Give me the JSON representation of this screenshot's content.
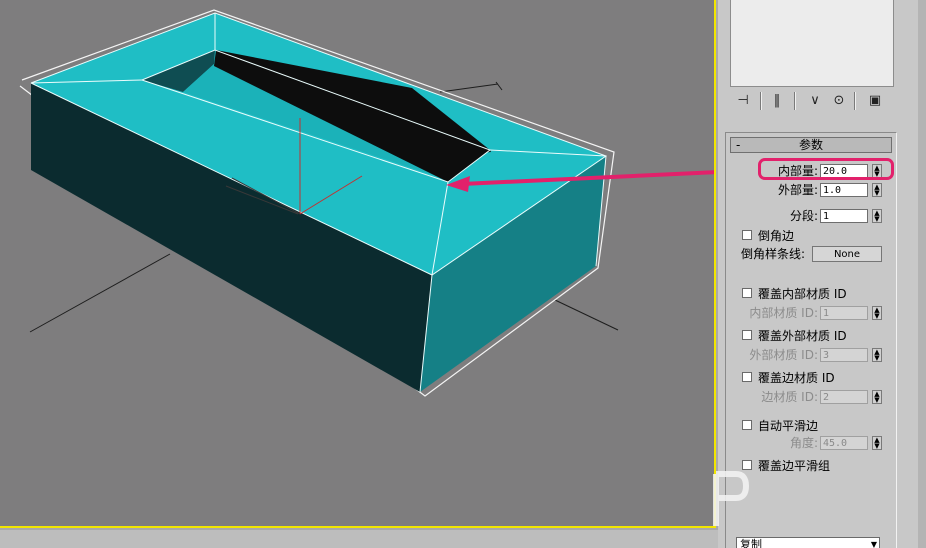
{
  "colors": {
    "viewport_bg": "#7e7d7e",
    "active_border": "#f2e600",
    "box_top": "#1fbec5",
    "box_side_dark": "#0b2b2f",
    "box_side_right": "#158086",
    "annotation": "#e2216b"
  },
  "viewport": {
    "object": "hollow-box"
  },
  "toolbar": {
    "icons": [
      "pin-icon",
      "pipe-icon",
      "fork-icon",
      "lock-icon",
      "configure-icon"
    ]
  },
  "rollout": {
    "minus": "-",
    "title": "参数"
  },
  "params": {
    "inner_amount": {
      "label": "内部量:",
      "value": "20.0"
    },
    "outer_amount": {
      "label": "外部量:",
      "value": "1.0"
    },
    "segments": {
      "label": "分段:",
      "value": "1"
    },
    "bevel_edge": {
      "label": "倒角边"
    },
    "bevel_spline": {
      "label": "倒角样条线:",
      "button": "None"
    },
    "override_inner_mat": {
      "label": "覆盖内部材质 ID"
    },
    "inner_mat_id": {
      "label": "内部材质 ID:",
      "value": "1"
    },
    "override_outer_mat": {
      "label": "覆盖外部材质 ID"
    },
    "outer_mat_id": {
      "label": "外部材质 ID:",
      "value": "3"
    },
    "override_edge_mat": {
      "label": "覆盖边材质 ID"
    },
    "edge_mat_id": {
      "label": "边材质 ID:",
      "value": "2"
    },
    "auto_smooth": {
      "label": "自动平滑边"
    },
    "angle": {
      "label": "角度:",
      "value": "45.0"
    },
    "override_smooth": {
      "label": "覆盖边平滑组"
    }
  },
  "bottom": {
    "dropdown": "复制"
  }
}
